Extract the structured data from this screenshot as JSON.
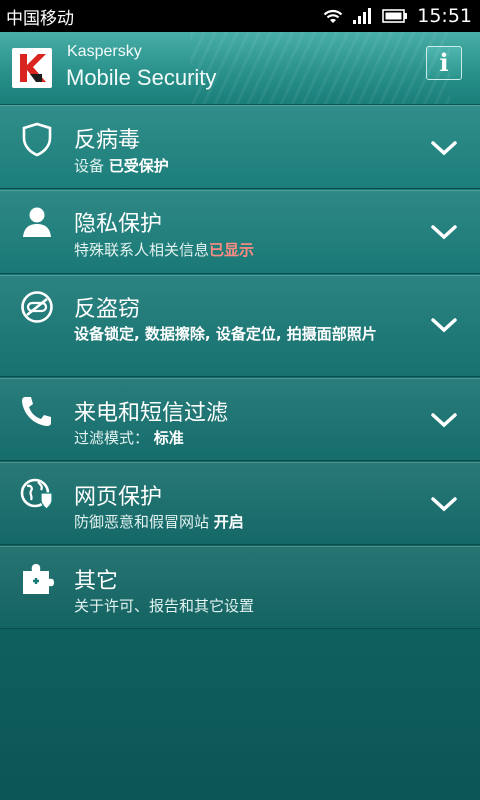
{
  "status_bar": {
    "carrier": "中国移动",
    "time": "15:51"
  },
  "header": {
    "brand_small": "Kaspersky",
    "brand_big": "Mobile Security",
    "info_label": "i"
  },
  "menu": [
    {
      "icon": "shield-icon",
      "title": "反病毒",
      "subtitle_prefix": "设备",
      "subtitle_highlight": "已受保护"
    },
    {
      "icon": "person-icon",
      "title": "隐私保护",
      "subtitle_prefix": "特殊联系人相关信息",
      "subtitle_highlight": "已显示",
      "highlight_color": "#ff8c83"
    },
    {
      "icon": "anti-theft-icon",
      "title": "反盗窃",
      "subtitle": "设备锁定, 数据擦除, 设备定位, 拍摄面部照片"
    },
    {
      "icon": "phone-icon",
      "title": "来电和短信过滤",
      "subtitle_prefix": "过滤模式：",
      "subtitle_highlight": "标准"
    },
    {
      "icon": "globe-shield-icon",
      "title": "网页保护",
      "subtitle_prefix": "防御恶意和假冒网站",
      "subtitle_highlight": "开启"
    },
    {
      "icon": "puzzle-icon",
      "title": "其它",
      "subtitle_prefix": "关于许可、报告和其它设置"
    }
  ]
}
